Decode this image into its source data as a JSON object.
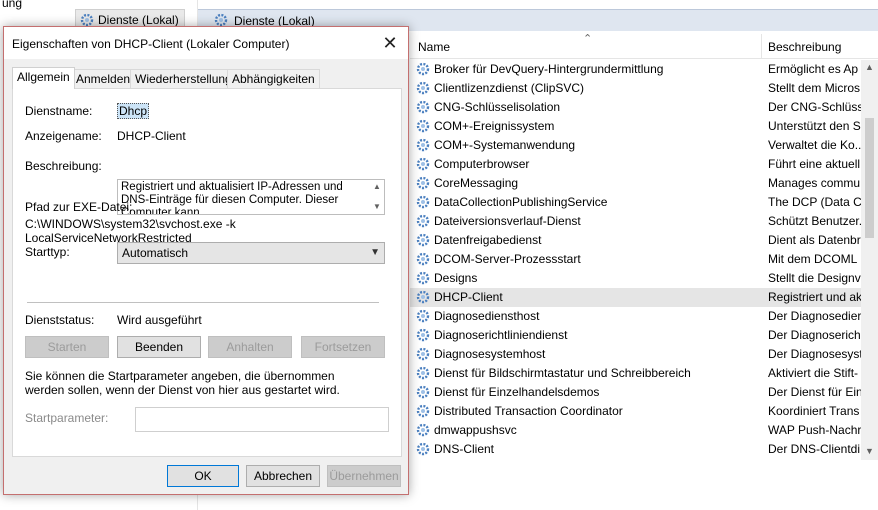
{
  "background": {
    "left_fragment": "ung",
    "tree_node": "Dienste (Lokal)",
    "header_title": "Dienste (Lokal)",
    "columns": {
      "name": "Name",
      "description": "Beschreibung"
    },
    "services": [
      {
        "name": "Broker für DevQuery-Hintergrundermittlung",
        "desc": "Ermöglicht es Ap"
      },
      {
        "name": "Clientlizenzdienst (ClipSVC)",
        "desc": "Stellt dem Micros"
      },
      {
        "name": "CNG-Schlüsselisolation",
        "desc": "Der CNG-Schlüss"
      },
      {
        "name": "COM+-Ereignissystem",
        "desc": "Unterstützt den S"
      },
      {
        "name": "COM+-Systemanwendung",
        "desc": "Verwaltet die Ko..."
      },
      {
        "name": "Computerbrowser",
        "desc": "Führt eine aktuell"
      },
      {
        "name": "CoreMessaging",
        "desc": "Manages commu"
      },
      {
        "name": "DataCollectionPublishingService",
        "desc": "The DCP (Data C..."
      },
      {
        "name": "Dateiversionsverlauf-Dienst",
        "desc": "Schützt Benutzer..."
      },
      {
        "name": "Datenfreigabedienst",
        "desc": "Dient als Datenbr"
      },
      {
        "name": "DCOM-Server-Prozessstart",
        "desc": "Mit dem DCOML"
      },
      {
        "name": "Designs",
        "desc": "Stellt die Designv"
      },
      {
        "name": "DHCP-Client",
        "desc": "Registriert und ak",
        "selected": true
      },
      {
        "name": "Diagnosediensthost",
        "desc": "Der Diagnosedier"
      },
      {
        "name": "Diagnoserichtliniendienst",
        "desc": "Der Diagnoserich"
      },
      {
        "name": "Diagnosesystemhost",
        "desc": "Der Diagnosesyst"
      },
      {
        "name": "Dienst für Bildschirmtastatur und Schreibbereich",
        "desc": "Aktiviert die Stift-"
      },
      {
        "name": "Dienst für Einzelhandelsdemos",
        "desc": "Der Dienst für Ein"
      },
      {
        "name": "Distributed Transaction Coordinator",
        "desc": "Koordiniert Trans"
      },
      {
        "name": "dmwappushsvc",
        "desc": "WAP Push-Nachr"
      },
      {
        "name": "DNS-Client",
        "desc": "Der DNS-Clientdi"
      }
    ]
  },
  "dialog": {
    "title": "Eigenschaften von DHCP-Client (Lokaler Computer)",
    "tabs": [
      "Allgemein",
      "Anmelden",
      "Wiederherstellung",
      "Abhängigkeiten"
    ],
    "labels": {
      "service_name": "Dienstname:",
      "display_name": "Anzeigename:",
      "description": "Beschreibung:",
      "exe_path": "Pfad zur EXE-Datei:",
      "start_type": "Starttyp:",
      "status": "Dienststatus:",
      "hint": "Sie können die Startparameter angeben, die übernommen werden sollen, wenn der Dienst von hier aus gestartet wird.",
      "start_params": "Startparameter:"
    },
    "values": {
      "service_name": "Dhcp",
      "display_name": "DHCP-Client",
      "description": "Registriert und aktualisiert IP-Adressen und DNS-Einträge für diesen Computer. Dieser Computer kann",
      "exe_path": "C:\\WINDOWS\\system32\\svchost.exe -k LocalServiceNetworkRestricted",
      "start_type": "Automatisch",
      "status": "Wird ausgeführt",
      "start_params": ""
    },
    "service_buttons": {
      "start": "Starten",
      "stop": "Beenden",
      "pause": "Anhalten",
      "resume": "Fortsetzen"
    },
    "footer_buttons": {
      "ok": "OK",
      "cancel": "Abbrechen",
      "apply": "Übernehmen"
    }
  }
}
